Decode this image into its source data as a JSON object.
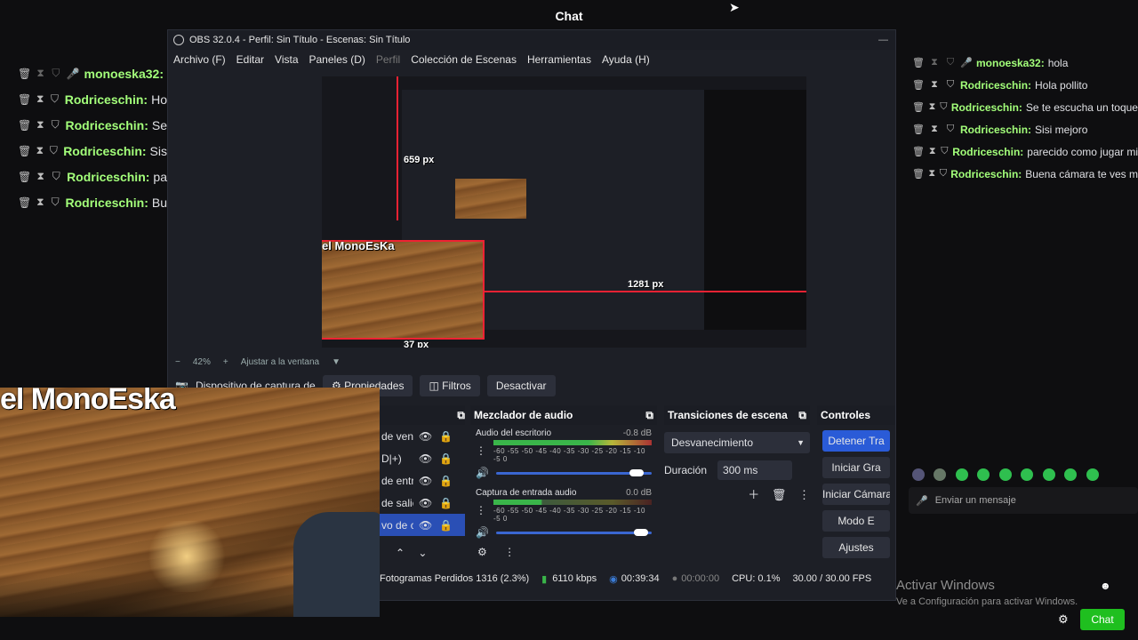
{
  "topbar": {
    "title": "Chat"
  },
  "left_chat": {
    "lines": [
      {
        "icons": [
          "trash",
          "hourglass",
          "shield"
        ],
        "user": "monoeska32:",
        "text": "",
        "mic": true
      },
      {
        "icons": [
          "trash",
          "hourglass",
          "shield"
        ],
        "user": "Rodriceschin:",
        "text": "Ho"
      },
      {
        "icons": [
          "trash",
          "hourglass",
          "shield"
        ],
        "user": "Rodriceschin:",
        "text": "Se"
      },
      {
        "icons": [
          "trash",
          "hourglass",
          "shield"
        ],
        "user": "Rodriceschin:",
        "text": "Sis"
      },
      {
        "icons": [
          "trash",
          "hourglass",
          "shield"
        ],
        "user": "Rodriceschin:",
        "text": "pa"
      },
      {
        "icons": [
          "trash",
          "hourglass",
          "shield"
        ],
        "user": "Rodriceschin:",
        "text": "Bu"
      }
    ]
  },
  "right_chat": {
    "lines": [
      {
        "user": "monoeska32:",
        "text": "hola",
        "mic": true
      },
      {
        "user": "Rodriceschin:",
        "text": "Hola pollito"
      },
      {
        "user": "Rodriceschin:",
        "text": "Se te escucha un toque"
      },
      {
        "user": "Rodriceschin:",
        "text": "Sisi mejoro"
      },
      {
        "user": "Rodriceschin:",
        "text": "parecido como jugar mi"
      },
      {
        "user": "Rodriceschin:",
        "text": "Buena cámara te ves m"
      }
    ],
    "input_placeholder": "Enviar un mensaje",
    "chat_button": "Chat"
  },
  "obs": {
    "title": "OBS 32.0.4 - Perfil: Sin Título - Escenas: Sin Título",
    "menu": [
      "Archivo (F)",
      "Editar",
      "Vista",
      "Paneles (D)",
      "Perfil",
      "Colección de Escenas",
      "Herramientas",
      "Ayuda (H)"
    ],
    "preview": {
      "label_top": "659 px",
      "label_right": "1281 px",
      "label_bottom": "37 px",
      "cam_label": "el MonoEsKa"
    },
    "zoom": {
      "minus": "−",
      "value": "42%",
      "plus": "+",
      "fit": "Ajustar a la ventana"
    },
    "source_bar": {
      "source": "Dispositivo de captura de v",
      "properties": "Propiedades",
      "filters": "Filtros",
      "disable": "Desactivar"
    },
    "sources_list": [
      "de vent",
      "D|+)",
      "de entr",
      "de salic",
      "vo de c"
    ],
    "audio": {
      "title": "Mezclador de audio",
      "channels": [
        {
          "name": "Audio del escritorio",
          "db": "-0.8 dB",
          "level": 0.75,
          "volume": 0.93
        },
        {
          "name": "Captura de entrada audio",
          "db": "0.0 dB",
          "level": 0.32,
          "volume": 0.97
        }
      ],
      "scale": "-60 -55 -50 -45 -40 -35 -30 -25 -20 -15 -10 -5 0"
    },
    "transitions": {
      "title": "Transiciones de escena",
      "type": "Desvanecimiento",
      "duration_label": "Duración",
      "duration": "300 ms"
    },
    "controls": {
      "title": "Controles",
      "buttons": [
        "Detener Tra",
        "Iniciar Gra",
        "Iniciar Cámara",
        "Modo E",
        "Ajustes"
      ]
    },
    "status": {
      "dropped": "Fotogramas Perdidos 1316 (2.3%)",
      "bitrate": "6110 kbps",
      "stream_time": "00:39:34",
      "rec_time": "00:00:00",
      "cpu": "CPU: 0.1%",
      "fps": "30.00 / 30.00 FPS"
    }
  },
  "webcam": {
    "label": "el MonoEska"
  },
  "watermark": {
    "line1": "Activar Windows",
    "line2": "Ve a Configuración para activar Windows."
  },
  "colors": {
    "accent_green": "#1fbf1f",
    "user_green": "#a3ff7a",
    "selection_red": "#e22233",
    "obs_bg": "#1d1f26"
  }
}
